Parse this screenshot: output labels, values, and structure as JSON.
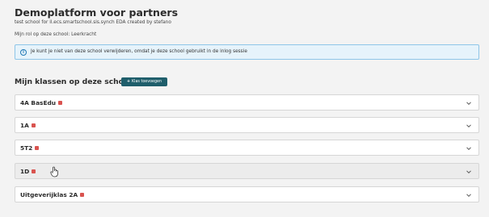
{
  "header": {
    "title": "Demoplatform voor partners",
    "subtitle": "test school for il.ecs.smartschool.sis.synch EDA created by stefano",
    "role": "Mijn rol op deze school: Leerkracht"
  },
  "alert": {
    "icon": "info-icon",
    "text": "Je kunt je niet van deze school verwijderen, omdat je deze school gebruikt in de inlog sessie"
  },
  "classes_section": {
    "title": "Mijn klassen op deze school",
    "add_button_label": "Klas toevoegen",
    "items": [
      {
        "name": "4A BasEdu"
      },
      {
        "name": "1A"
      },
      {
        "name": "5T2"
      },
      {
        "name": "1D"
      },
      {
        "name": "Uitgeverijklas 2A"
      }
    ]
  },
  "colors": {
    "accent": "#1f5e6b",
    "alert_bg": "#e6f3fb",
    "alert_border": "#8ec5e8",
    "badge": "#d9534f"
  }
}
